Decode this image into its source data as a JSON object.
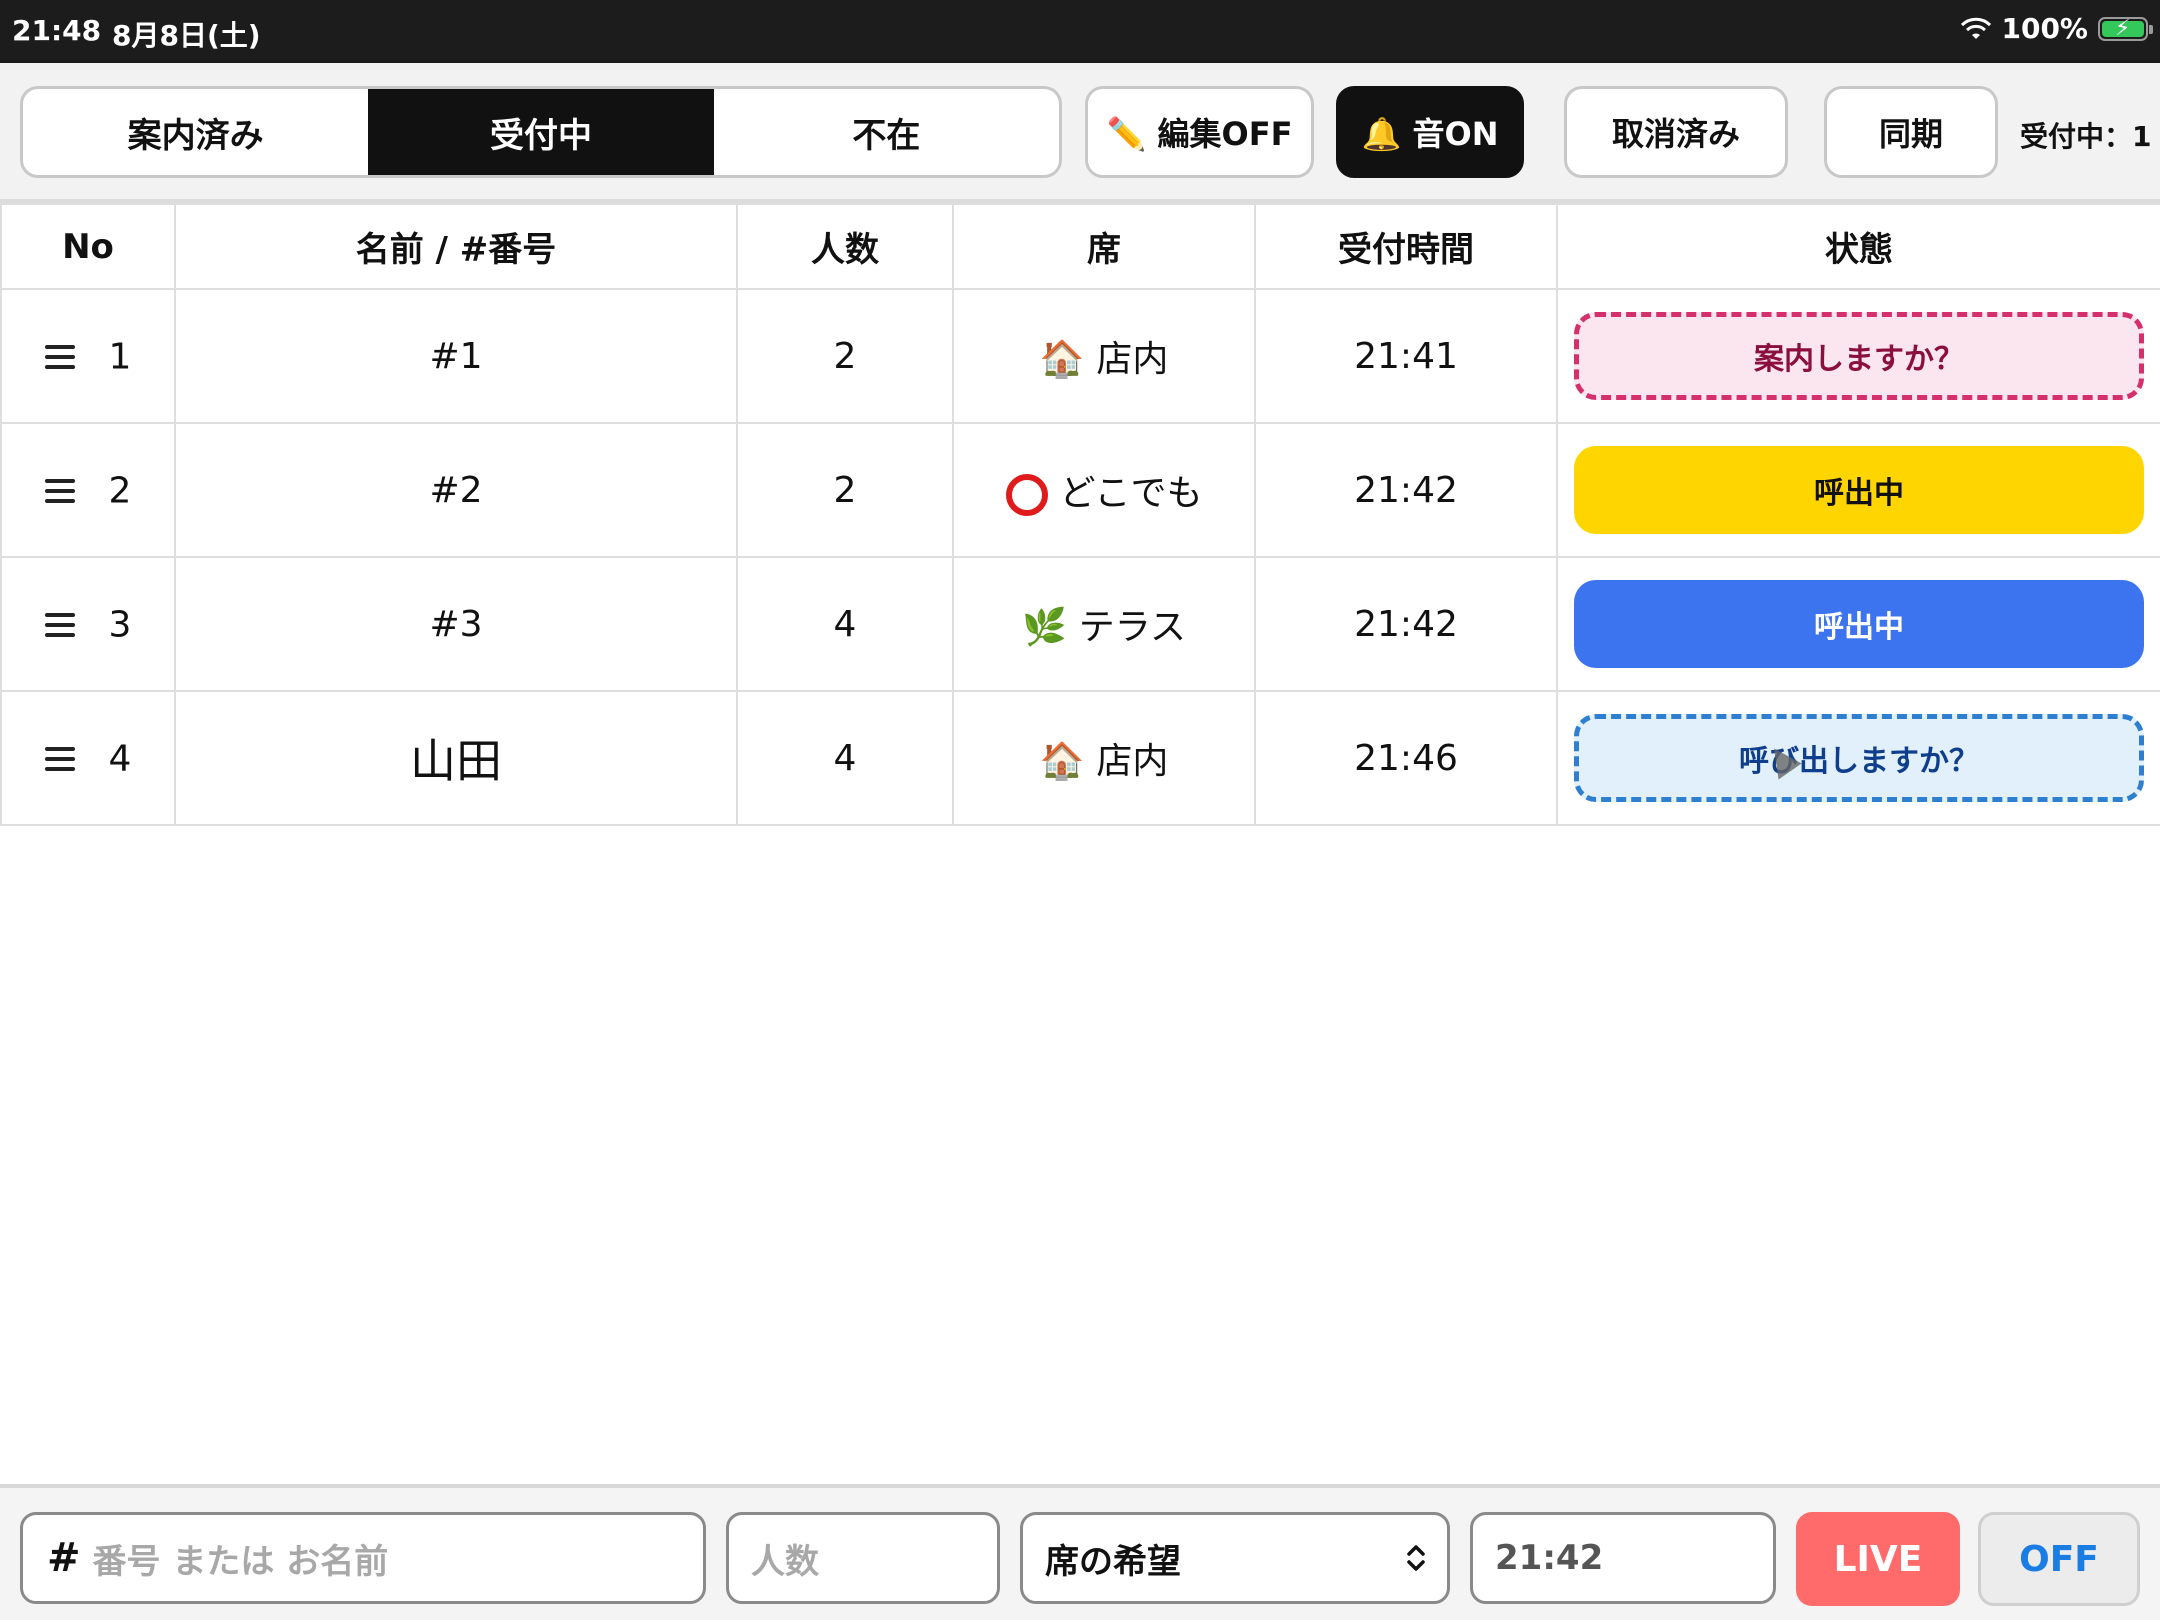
{
  "status_bar": {
    "time": "21:48",
    "date": "8月8日(土)",
    "battery": "100%"
  },
  "toolbar": {
    "tabs": [
      {
        "label": "案内済み",
        "active": false
      },
      {
        "label": "受付中",
        "active": true
      },
      {
        "label": "不在",
        "active": false
      }
    ],
    "edit_label": "✏️ 編集OFF",
    "sound_label": "🔔 音ON",
    "cancelled_label": "取消済み",
    "sync_label": "同期",
    "count_label": "受付中：1"
  },
  "table": {
    "headers": [
      "No",
      "名前 / #番号",
      "人数",
      "席",
      "受付時間",
      "状態"
    ],
    "rows": [
      {
        "no": "1",
        "name": "#1",
        "people": "2",
        "seat_icon": "🏠",
        "seat": "店内",
        "time": "21:41",
        "status": "案内しますか？"
      },
      {
        "no": "2",
        "name": "#2",
        "people": "2",
        "seat_icon": "",
        "seat": "どこでも",
        "time": "21:42",
        "status": "呼出中"
      },
      {
        "no": "3",
        "name": "#3",
        "people": "4",
        "seat_icon": "🌿",
        "seat": "テラス",
        "time": "21:42",
        "status": "呼出中"
      },
      {
        "no": "4",
        "name": "山田",
        "people": "4",
        "seat_icon": "🏠",
        "seat": "店内",
        "time": "21:46",
        "status": "呼び出しますか？"
      }
    ]
  },
  "bottom": {
    "name_placeholder": "番号 または お名前",
    "people_placeholder": "人数",
    "seat_select": "席の希望",
    "time_value": "21:42",
    "live_label": "LIVE",
    "off_label": "OFF"
  },
  "colors": {
    "pink_status": "#d52f6c",
    "yellow_status": "#ffd500",
    "blue_status": "#3b74ee",
    "lightblue_status": "#2f7fd1",
    "live": "#ff6b6b"
  }
}
